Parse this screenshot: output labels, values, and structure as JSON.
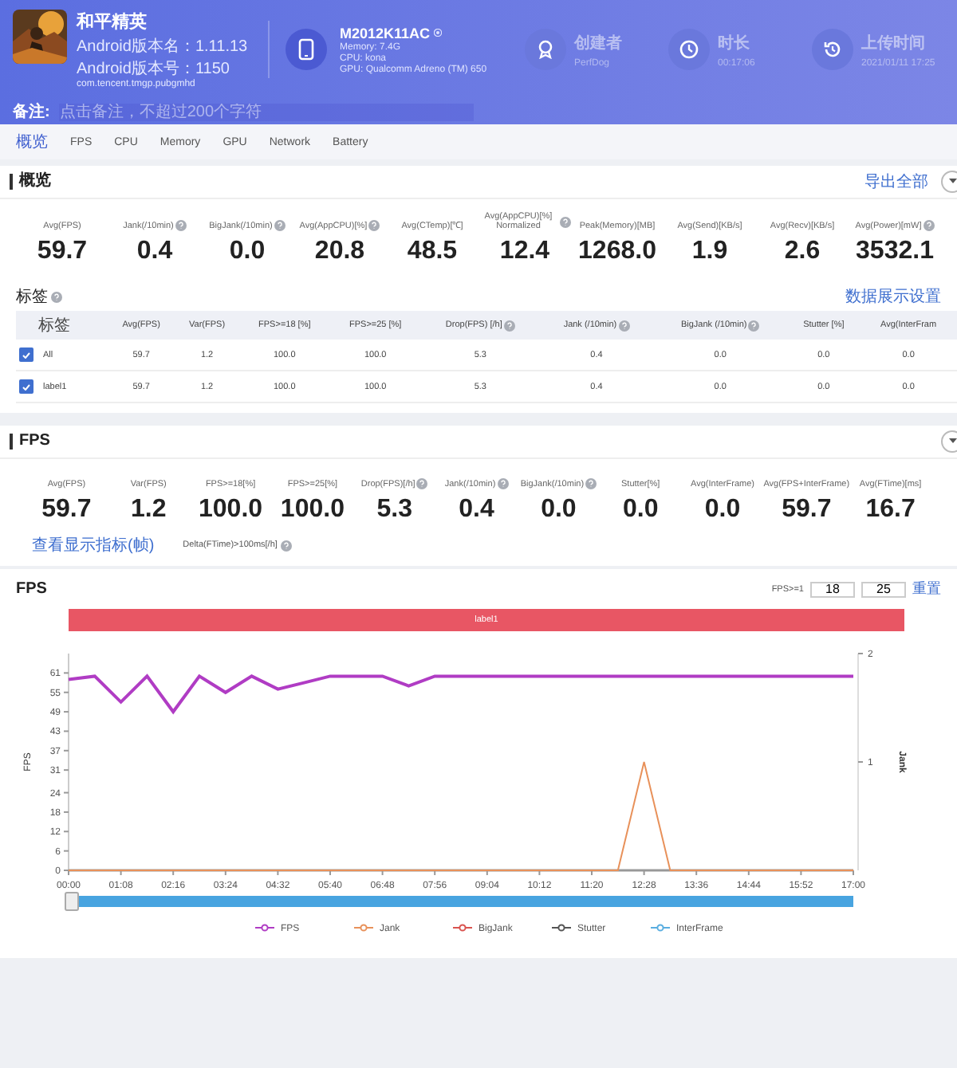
{
  "app": {
    "name": "和平精英",
    "version_name": "Android版本名：1.11.13",
    "version_code": "Android版本号：1150",
    "package": "com.tencent.tmgp.pubgmhd"
  },
  "device": {
    "model": "M2012K11AC",
    "memory": "Memory: 7.4G",
    "cpu": "CPU: kona",
    "gpu": "GPU: Qualcomm Adreno (TM) 650"
  },
  "stats": [
    {
      "kind": "user",
      "label": "创建者",
      "value": "PerfDog"
    },
    {
      "kind": "duration",
      "label": "时长",
      "value": "00:17:06"
    },
    {
      "kind": "upload",
      "label": "上传时间",
      "value": "2021/01/11 17:25"
    }
  ],
  "remark": {
    "label": "备注:",
    "placeholder": "点击备注，不超过200个字符"
  },
  "tabs": [
    {
      "label": "概览",
      "selected": true
    },
    {
      "label": "FPS",
      "selected": false
    },
    {
      "label": "CPU",
      "selected": false
    },
    {
      "label": "Memory",
      "selected": false
    },
    {
      "label": "GPU",
      "selected": false
    },
    {
      "label": "Network",
      "selected": false
    },
    {
      "label": "Battery",
      "selected": false
    }
  ],
  "overview": {
    "title": "概览",
    "export": "导出全部",
    "metrics": [
      {
        "label": "Avg(FPS)",
        "value": "59.7",
        "help": false
      },
      {
        "label": "Jank(/10min)",
        "value": "0.4",
        "help": true
      },
      {
        "label": "BigJank(/10min)",
        "value": "0.0",
        "help": true
      },
      {
        "label": "Avg(AppCPU)[%]",
        "value": "20.8",
        "help": true
      },
      {
        "label": "Avg(CTemp)[℃]",
        "value": "48.5",
        "help": false
      },
      {
        "label": "Avg(AppCPU)[%] Normalized",
        "value": "12.4",
        "help": true
      },
      {
        "label": "Peak(Memory)[MB]",
        "value": "1268.0",
        "help": false
      },
      {
        "label": "Avg(Send)[KB/s]",
        "value": "1.9",
        "help": false
      },
      {
        "label": "Avg(Recv)[KB/s]",
        "value": "2.6",
        "help": false
      },
      {
        "label": "Avg(Power)[mW]",
        "value": "3532.1",
        "help": true
      }
    ],
    "tags": {
      "title": "标签",
      "settings": "数据展示设置",
      "columns": [
        {
          "label": "标签",
          "help": false
        },
        {
          "label": "Avg(FPS)",
          "help": false
        },
        {
          "label": "Var(FPS)",
          "help": false
        },
        {
          "label": "FPS>=18 [%]",
          "help": false
        },
        {
          "label": "FPS>=25 [%]",
          "help": false
        },
        {
          "label": "Drop(FPS) [/h]",
          "help": true
        },
        {
          "label": "Jank (/10min)",
          "help": true
        },
        {
          "label": "BigJank (/10min)",
          "help": true
        },
        {
          "label": "Stutter [%]",
          "help": false
        },
        {
          "label": "Avg(InterFram",
          "help": false
        }
      ],
      "rows": [
        {
          "checked": true,
          "cells": [
            "All",
            "59.7",
            "1.2",
            "100.0",
            "100.0",
            "5.3",
            "0.4",
            "0.0",
            "0.0",
            "0.0"
          ]
        },
        {
          "checked": true,
          "cells": [
            "label1",
            "59.7",
            "1.2",
            "100.0",
            "100.0",
            "5.3",
            "0.4",
            "0.0",
            "0.0",
            "0.0"
          ]
        }
      ]
    }
  },
  "fps": {
    "title": "FPS",
    "metrics": [
      {
        "label": "Avg(FPS)",
        "value": "59.7",
        "help": false
      },
      {
        "label": "Var(FPS)",
        "value": "1.2",
        "help": false
      },
      {
        "label": "FPS>=18[%]",
        "value": "100.0",
        "help": false
      },
      {
        "label": "FPS>=25[%]",
        "value": "100.0",
        "help": false
      },
      {
        "label": "Drop(FPS)[/h]",
        "value": "5.3",
        "help": true
      },
      {
        "label": "Jank(/10min)",
        "value": "0.4",
        "help": true
      },
      {
        "label": "BigJank(/10min)",
        "value": "0.0",
        "help": true
      },
      {
        "label": "Stutter[%]",
        "value": "0.0",
        "help": false
      },
      {
        "label": "Avg(InterFrame)",
        "value": "0.0",
        "help": false
      },
      {
        "label": "Avg(FPS+InterFrame)",
        "value": "59.7",
        "help": false
      },
      {
        "label": "Avg(FTime)[ms]",
        "value": "16.7",
        "help": false
      }
    ],
    "extras": [
      {
        "kind": "link",
        "label": "查看显示指标(帧)",
        "help": false
      },
      {
        "kind": "text",
        "label": "Delta(FTime)>100ms[/h]",
        "help": true
      }
    ],
    "chart": {
      "title": "FPS",
      "threshold_label": "FPS>=1",
      "thresholds": [
        "18",
        "25"
      ],
      "reset": "重置",
      "label_bar": "label1",
      "right_axis_label": "Jank",
      "chart_data": {
        "type": "line",
        "ylabel": "FPS",
        "xlim": [
          0,
          1020
        ],
        "legend": "bottom",
        "x": [
          0,
          34,
          68,
          102,
          136,
          170,
          204,
          238,
          272,
          306,
          340,
          374,
          408,
          442,
          476,
          510,
          544,
          578,
          612,
          646,
          680,
          714,
          748,
          782,
          816,
          850,
          884,
          918,
          952,
          986,
          1020
        ],
        "xticks": [
          {
            "value": 0,
            "label": "00:00"
          },
          {
            "value": 68,
            "label": "01:08"
          },
          {
            "value": 136,
            "label": "02:16"
          },
          {
            "value": 204,
            "label": "03:24"
          },
          {
            "value": 272,
            "label": "04:32"
          },
          {
            "value": 340,
            "label": "05:40"
          },
          {
            "value": 408,
            "label": "06:48"
          },
          {
            "value": 476,
            "label": "07:56"
          },
          {
            "value": 544,
            "label": "09:04"
          },
          {
            "value": 612,
            "label": "10:12"
          },
          {
            "value": 680,
            "label": "11:20"
          },
          {
            "value": 748,
            "label": "12:28"
          },
          {
            "value": 816,
            "label": "13:36"
          },
          {
            "value": 884,
            "label": "14:44"
          },
          {
            "value": 952,
            "label": "15:52"
          },
          {
            "value": 1020,
            "label": "17:00"
          }
        ],
        "ylim": [
          0,
          67
        ],
        "yticks": [
          0,
          6,
          12,
          18,
          24,
          31,
          37,
          43,
          49,
          55,
          61
        ],
        "y2lim": [
          0,
          2
        ],
        "y2ticks": [
          1,
          2
        ],
        "series": [
          {
            "name": "FPS",
            "color": "#b03cc4",
            "values": [
              59,
              60,
              52,
              60,
              49,
              60,
              55,
              60,
              56,
              58,
              60,
              60,
              60,
              57,
              60,
              60,
              60,
              60,
              60,
              60,
              60,
              60,
              60,
              60,
              60,
              60,
              60,
              60,
              60,
              60,
              60
            ]
          },
          {
            "name": "Jank",
            "color": "#e8915a",
            "axis": "y2",
            "values": [
              0,
              0,
              0,
              0,
              0,
              0,
              0,
              0,
              0,
              0,
              0,
              0,
              0,
              0,
              0,
              0,
              0,
              0,
              0,
              0,
              0,
              0,
              1,
              0,
              0,
              0,
              0,
              0,
              0,
              0,
              0
            ]
          },
          {
            "name": "BigJank",
            "color": "#d9534f",
            "axis": "y2",
            "values": [
              null,
              null,
              null,
              null,
              null,
              null,
              null,
              null,
              null,
              null,
              null,
              null,
              null,
              null,
              null,
              null,
              null,
              null,
              null,
              null,
              null,
              null,
              null,
              null,
              null,
              null,
              null,
              null,
              null,
              null,
              null
            ]
          },
          {
            "name": "Stutter",
            "color": "#555555",
            "values": [
              null,
              null,
              null,
              null,
              null,
              null,
              null,
              null,
              null,
              null,
              null,
              null,
              null,
              null,
              null,
              null,
              null,
              null,
              null,
              null,
              null,
              null,
              null,
              null,
              null,
              null,
              null,
              null,
              null,
              null,
              null
            ]
          },
          {
            "name": "InterFrame",
            "color": "#5aaee0",
            "values": [
              null,
              null,
              null,
              null,
              null,
              null,
              null,
              null,
              null,
              null,
              null,
              null,
              null,
              null,
              null,
              null,
              null,
              null,
              null,
              null,
              null,
              null,
              null,
              null,
              null,
              null,
              null,
              null,
              null,
              null,
              null
            ]
          }
        ]
      }
    }
  }
}
